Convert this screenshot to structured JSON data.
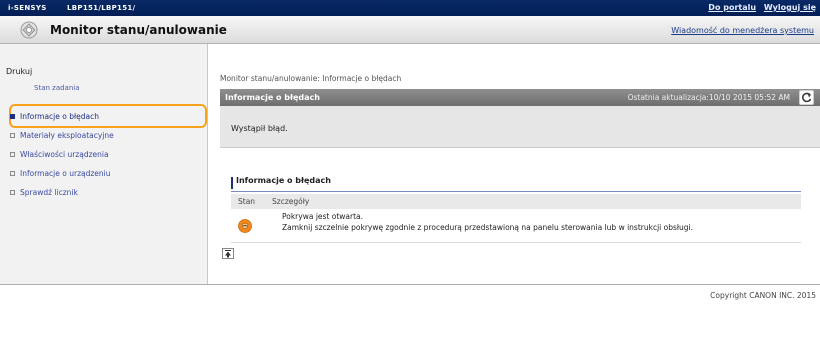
{
  "topbar": {
    "brand": "i-SENSYS",
    "model": "LBP151/LBP151/",
    "links": [
      "Do portalu",
      "Wyloguj się"
    ]
  },
  "header": {
    "title": "Monitor stanu/anulowanie",
    "manager_link": "Wiadomość do menedżera systemu"
  },
  "sidebar": {
    "heading": "Drukuj",
    "sub_item": "Stan zadania",
    "items": [
      {
        "label": "Informacje o błędach",
        "active": true
      },
      {
        "label": "Materiały eksploatacyjne",
        "active": false
      },
      {
        "label": "Właściwości urządzenia",
        "active": false
      },
      {
        "label": "Informacje o urządzeniu",
        "active": false
      },
      {
        "label": "Sprawdź licznik",
        "active": false
      }
    ]
  },
  "main": {
    "breadcrumb": "Monitor stanu/anulowanie: Informacje o błędach",
    "panel_title": "Informacje o błędach",
    "last_updated": "Ostatnia aktualizacja:10/10 2015 05:52 AM",
    "message": "Wystąpił błąd.",
    "section_title": "Informacje o błędach",
    "table": {
      "headers": [
        "Stan",
        "Szczegóły"
      ],
      "rows": [
        {
          "status_icon": "warning-icon",
          "detail_line1": "Pokrywa jest otwarta.",
          "detail_line2": "Zamknij szczelnie pokrywę zgodnie z procedurą przedstawioną na panelu sterowania lub w instrukcji obsługi."
        }
      ]
    }
  },
  "footer": {
    "copyright": "Copyright CANON INC. 2015"
  },
  "colors": {
    "topbar": "#001e55",
    "highlight": "#f7a21b",
    "link": "#1a3a8a",
    "warning": "#f08a1c"
  }
}
